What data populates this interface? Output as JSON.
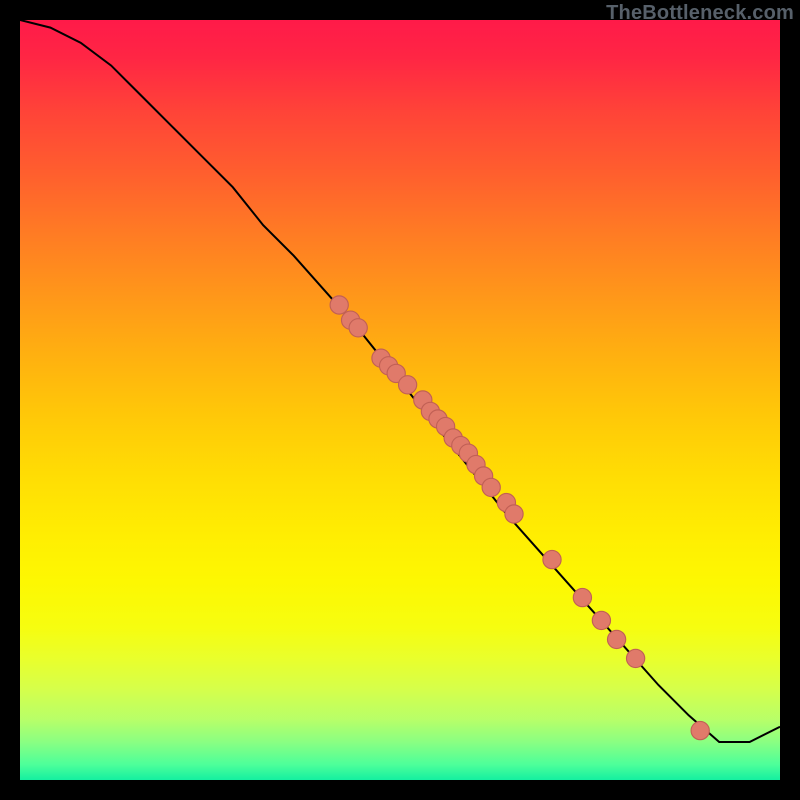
{
  "watermark": "TheBottleneck.com",
  "colors": {
    "curve": "#000000",
    "marker_fill": "#e07a6a",
    "marker_stroke": "#c16055",
    "background_black": "#000000"
  },
  "chart_data": {
    "type": "line",
    "title": "",
    "xlabel": "",
    "ylabel": "",
    "xlim": [
      0,
      100
    ],
    "ylim": [
      0,
      100
    ],
    "grid": false,
    "legend": false,
    "series": [
      {
        "name": "curve",
        "kind": "line",
        "x": [
          0,
          4,
          8,
          12,
          16,
          20,
          24,
          28,
          32,
          36,
          40,
          44,
          48,
          52,
          56,
          60,
          64,
          68,
          72,
          76,
          80,
          84,
          88,
          92,
          96,
          100
        ],
        "y": [
          100,
          99,
          97,
          94,
          90,
          86,
          82,
          78,
          73,
          69,
          64.5,
          60,
          55,
          50,
          45,
          40,
          35,
          30.5,
          26,
          21.5,
          17,
          12.5,
          8.5,
          5,
          5,
          7
        ]
      },
      {
        "name": "markers",
        "kind": "scatter",
        "x": [
          42,
          43.5,
          44.5,
          47.5,
          48.5,
          49.5,
          51,
          53,
          54,
          55,
          56,
          57,
          58,
          59,
          60,
          61,
          62,
          64,
          65,
          70,
          74,
          76.5,
          78.5,
          81,
          89.5
        ],
        "y": [
          62.5,
          60.5,
          59.5,
          55.5,
          54.5,
          53.5,
          52,
          50,
          48.5,
          47.5,
          46.5,
          45,
          44,
          43,
          41.5,
          40,
          38.5,
          36.5,
          35,
          29,
          24,
          21,
          18.5,
          16,
          6.5
        ]
      }
    ]
  }
}
